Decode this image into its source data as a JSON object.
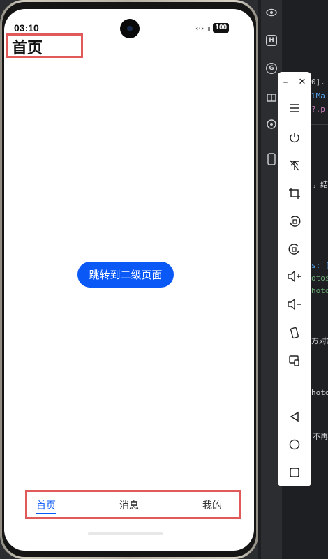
{
  "status_bar": {
    "time": "03:10",
    "signal_icons": "‹·› ᵢₗₗ",
    "battery": "100"
  },
  "page": {
    "title": "首页",
    "button_label": "跳转到二级页面"
  },
  "tabs": [
    {
      "label": "首页",
      "active": true
    },
    {
      "label": "消息",
      "active": false
    },
    {
      "label": "我的",
      "active": false
    }
  ],
  "ide_rail": {
    "icons": [
      "eye-icon",
      "h-box-icon",
      "g-circle-icon",
      "gift-icon",
      "gamepad-icon",
      "phone-icon"
    ],
    "h_label": "H",
    "g_label": "G"
  },
  "code_fragments": {
    "f1": "0].",
    "f2": "lMa",
    "f3": "?.p",
    "f4": "，结",
    "f5": "s: [",
    "f6": "otos",
    "f7": "hoto",
    "f8": "方对象",
    "f9": "hoto",
    "f10": "不再"
  },
  "emulator_toolbar": {
    "minimize": "–",
    "close": "✕",
    "icons": [
      "menu-icon",
      "power-icon",
      "pin-icon",
      "crop-icon",
      "rotate-left-icon",
      "rotate-right-icon",
      "volume-up-icon",
      "volume-down-icon",
      "shake-icon",
      "multi-screen-icon",
      "back-icon",
      "home-icon",
      "recents-icon"
    ]
  },
  "colors": {
    "accent": "#0a59f7",
    "highlight_box": "#e05a5a"
  }
}
